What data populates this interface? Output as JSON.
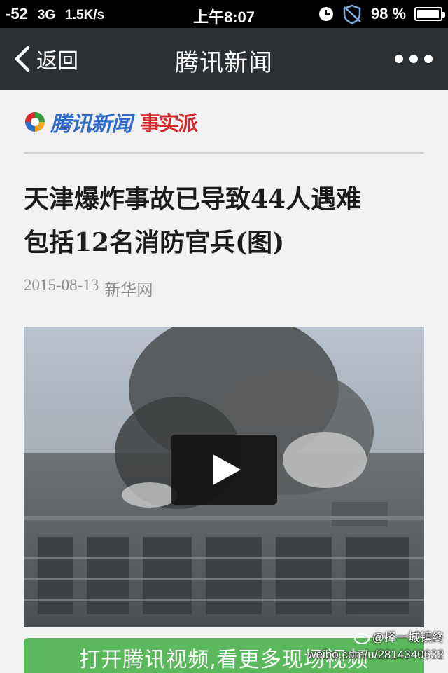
{
  "status_bar": {
    "signal": "-52",
    "network": "3G",
    "speed": "1.5K/s",
    "time": "上午8:07",
    "battery": "98",
    "battery_unit": "%",
    "icons": [
      "clock-icon",
      "no-disturb-icon",
      "battery-icon"
    ]
  },
  "nav": {
    "back_label": "返回",
    "title": "腾讯新闻",
    "more_icon": "more-dots-icon"
  },
  "brand": {
    "name": "腾讯新闻",
    "badge": "事实派"
  },
  "article": {
    "headline_line1": "天津爆炸事故已导致44人遇难",
    "headline_line2": "包括12名消防官兵(图)",
    "date": "2015-08-13",
    "source": "新华网"
  },
  "video": {
    "play_icon": "play-icon"
  },
  "cta": {
    "label": "打开腾讯视频,看更多现场视频"
  },
  "watermark": {
    "line1": "@择一城镇终",
    "line2": "weibo.com/u/2814340632"
  },
  "colors": {
    "nav_bg": "#2d3033",
    "brand_blue": "#2f6cc9",
    "brand_red": "#d7262c",
    "cta_green": "#5cb85c"
  }
}
